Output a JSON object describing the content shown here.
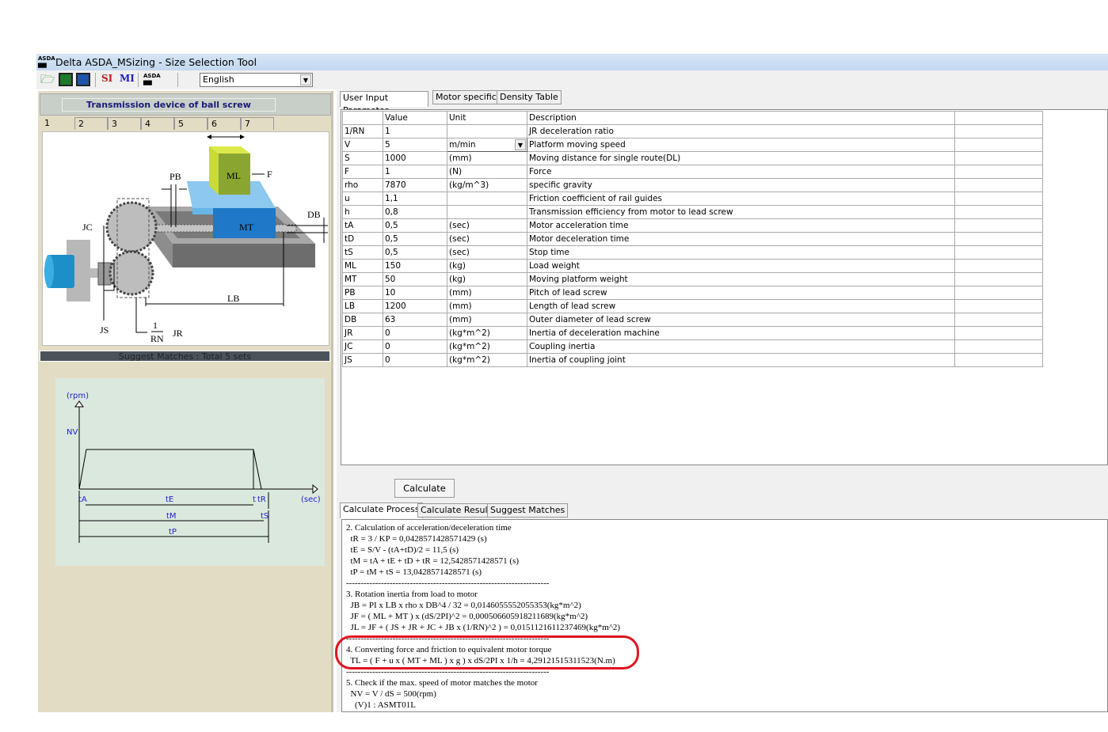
{
  "window": {
    "title": "Delta ASDA_MSizing - Size Selection Tool",
    "app_icon": "asda-icon"
  },
  "toolbar": {
    "icons": [
      "open-folder-icon",
      "save-green-icon",
      "save-blue-icon",
      "si-units-icon",
      "mi-units-icon",
      "asda-motor-icon"
    ],
    "si_label": "SI",
    "mi_label": "MI",
    "language": "English"
  },
  "left": {
    "title": "Transmission device of ball screw",
    "tabs": [
      "1",
      "2",
      "3",
      "4",
      "5",
      "6",
      "7"
    ],
    "diagram_labels": {
      "pb": "PB",
      "ml": "ML",
      "f": "F",
      "db": "DB",
      "mt": "MT",
      "jc": "JC",
      "lb": "LB",
      "js": "JS",
      "rn_num": "1",
      "rn_den": "RN",
      "jr": "JR"
    },
    "suggest": "Suggest Matches : Total  5 sets",
    "profile": {
      "y_unit": "(rpm)",
      "nv": "NV",
      "x_unit": "(sec)",
      "ta": "tA",
      "te": "tE",
      "td": "t",
      "tr": "tR",
      "tm": "tM",
      "ts": "tS",
      "tp": "tP"
    }
  },
  "right": {
    "tabs": [
      "User Input Parameter",
      "Motor specific",
      "Density Table"
    ],
    "columns": [
      "",
      "Value",
      "Unit",
      "Description",
      ""
    ],
    "rows": [
      [
        "1/RN",
        "1",
        "",
        "JR deceleration ratio"
      ],
      [
        "V",
        "5",
        "m/min",
        "Platform moving speed"
      ],
      [
        "S",
        "1000",
        "(mm)",
        "Moving distance for single route(DL)"
      ],
      [
        "F",
        "1",
        "(N)",
        "Force"
      ],
      [
        "rho",
        "7870",
        "(kg/m^3)",
        "specific gravity"
      ],
      [
        "u",
        "1,1",
        "",
        "Friction coefficient of rail guides"
      ],
      [
        "h",
        "0,8",
        "",
        "Transmission efficiency from motor to lead screw"
      ],
      [
        "tA",
        "0,5",
        "(sec)",
        "Motor acceleration time"
      ],
      [
        "tD",
        "0,5",
        "(sec)",
        "Motor deceleration time"
      ],
      [
        "tS",
        "0,5",
        "(sec)",
        "Stop time"
      ],
      [
        "ML",
        "150",
        "(kg)",
        "Load weight"
      ],
      [
        "MT",
        "50",
        "(kg)",
        "Moving platform weight"
      ],
      [
        "PB",
        "10",
        "(mm)",
        "Pitch of lead screw"
      ],
      [
        "LB",
        "1200",
        "(mm)",
        "Length of lead screw"
      ],
      [
        "DB",
        "63",
        "(mm)",
        "Outer diameter of lead screw"
      ],
      [
        "JR",
        "0",
        "(kg*m^2)",
        "Inertia of deceleration machine"
      ],
      [
        "JC",
        "0",
        "(kg*m^2)",
        "Coupling inertia"
      ],
      [
        "JS",
        "0",
        "(kg*m^2)",
        "Inertia of coupling joint"
      ]
    ],
    "calculate": "Calculate",
    "result_tabs": [
      "Calculate Process",
      "Calculate Result",
      "Suggest Matches"
    ],
    "process_lines": [
      "2. Calculation of acceleration/deceleration time",
      "  tR = 3 / KP = 0,0428571428571429 (s)",
      "  tE = S/V - (tA+tD)/2 = 11,5 (s)",
      "  tM = tA + tE + tD + tR = 12,5428571428571 (s)",
      "  tP = tM + tS = 13,0428571428571 (s)",
      "----------------------------------------------------------------------",
      "3. Rotation inertia from load to motor",
      "  JB = PI x LB x rho x DB^4 / 32 = 0,0146055552055353(kg*m^2)",
      "  JF = ( ML + MT ) x (dS/2PI)^2 = 0,000506605918211689(kg*m^2)",
      "  JL = JF + ( JS + JR + JC + JB x (1/RN)^2 ) = 0,0151121611237469(kg*m^2)",
      "----------------------------------------------------------------------",
      "4. Converting force and friction to equivalent motor torque",
      "  TL = ( F + u x ( MT + ML ) x g ) x dS/2PI x 1/h = 4,29121515311523(N.m)",
      "----------------------------------------------------------------------",
      "5. Check if the max. speed of motor matches the motor",
      "  NV = V / dS = 500(rpm)",
      "    (V)1 : ASMT01L"
    ],
    "highlight_color": "#e0141e"
  }
}
